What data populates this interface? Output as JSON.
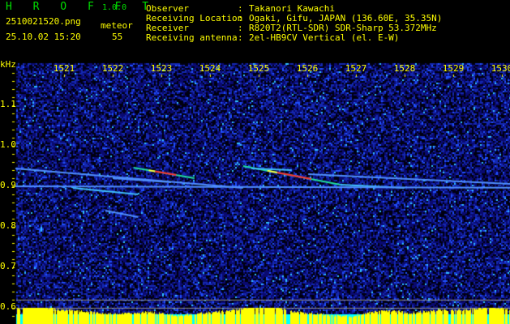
{
  "header": {
    "app_name": "H R O F F T",
    "version": "1.0.0",
    "filename": "2510021520.png",
    "datetime": "25.10.02 15:20",
    "meteor_label": "meteor",
    "meteor_count": "55",
    "info": [
      {
        "label": "Observer",
        "value": "Takanori Kawachi"
      },
      {
        "label": "Receiving Location",
        "value": "Ogaki, Gifu, JAPAN (136.60E, 35.35N)"
      },
      {
        "label": "Receiver",
        "value": "R820T2(RTL-SDR) SDR-Sharp 53.372MHz"
      },
      {
        "label": "Receiving antenna",
        "value": "2el-HB9CV Vertical (el. E-W)"
      }
    ],
    "separator": ":"
  },
  "colors": {
    "text": "#ffff00",
    "logo": "#00dd00",
    "background": "#000000",
    "noise": "#1020a0"
  },
  "chart_data": {
    "type": "heatmap",
    "title": "HROFFT spectrogram",
    "xlabel": "",
    "ylabel": "kHz",
    "x_ticks": [
      "1521",
      "1522",
      "1523",
      "1524",
      "1525",
      "1526",
      "1527",
      "1528",
      "1529",
      "1530"
    ],
    "y_ticks": [
      "1.1",
      "1.0",
      "0.9",
      "0.8",
      "0.7",
      "0.6"
    ],
    "xlim": [
      1520.0,
      1531.17
    ],
    "ylim": [
      0.56,
      1.0
    ],
    "ylim_display": [
      0.565,
      1.195
    ],
    "reference_lines_khz": [
      0.6,
      0.62
    ],
    "meteor_traces": [
      {
        "x": [
          1520.0,
          1524.68
        ],
        "y": [
          0.944,
          0.896
        ],
        "intensity": 0.6
      },
      {
        "x": [
          1522.43,
          1523.68
        ],
        "y": [
          0.946,
          0.92
        ],
        "intensity": 1.0
      },
      {
        "x": [
          1524.68,
          1526.68
        ],
        "y": [
          0.95,
          0.904
        ],
        "intensity": 1.0
      },
      {
        "x": [
          1526.68,
          1528.0
        ],
        "y": [
          0.904,
          0.896
        ],
        "intensity": 0.8
      },
      {
        "x": [
          1520.0,
          1531.17
        ],
        "y": [
          0.9,
          0.896
        ],
        "intensity": 0.45
      },
      {
        "x": [
          1521.18,
          1522.52
        ],
        "y": [
          0.896,
          0.88
        ],
        "intensity": 0.7
      },
      {
        "x": [
          1521.85,
          1522.52
        ],
        "y": [
          0.84,
          0.824
        ],
        "intensity": 0.55
      },
      {
        "x": [
          1526.02,
          1531.17
        ],
        "y": [
          0.93,
          0.9
        ],
        "intensity": 0.5
      },
      {
        "x": [
          1524.85,
          1525.68
        ],
        "y": [
          0.944,
          0.94
        ],
        "intensity": 0.7
      },
      {
        "x": [
          1522.0,
          1523.2
        ],
        "y": [
          0.92,
          0.91
        ],
        "intensity": 0.4
      }
    ]
  }
}
